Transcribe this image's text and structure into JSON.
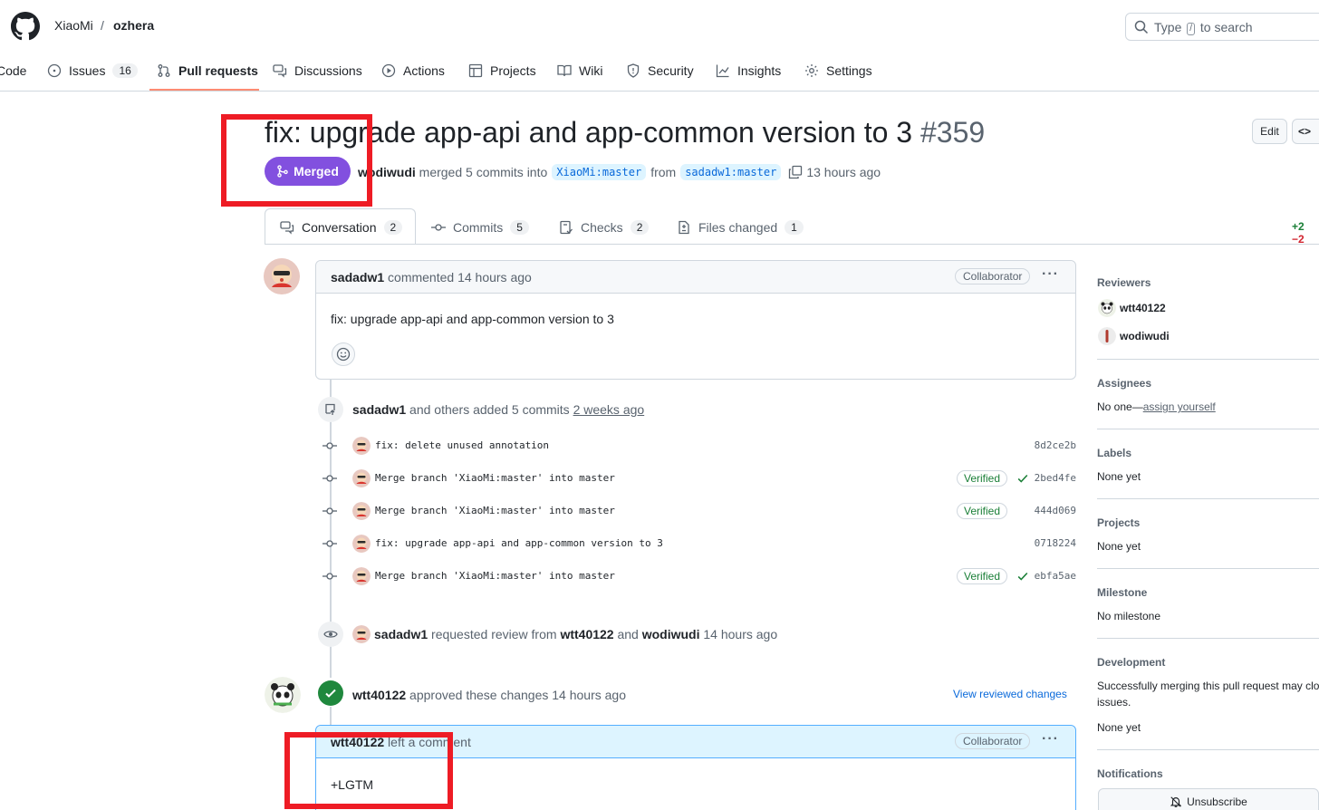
{
  "repo": {
    "owner": "XiaoMi",
    "separator": "/",
    "name": "ozhera"
  },
  "search": {
    "placeholder_prefix": "Type",
    "shortcut_key": "/",
    "placeholder_suffix": "to search"
  },
  "nav": {
    "tabs": [
      {
        "label": "Code",
        "icon": "code-icon"
      },
      {
        "label": "Issues",
        "count": "16",
        "icon": "issue-opened-icon"
      },
      {
        "label": "Pull requests",
        "icon": "git-pull-request-icon"
      },
      {
        "label": "Discussions",
        "icon": "comment-discussion-icon"
      },
      {
        "label": "Actions",
        "icon": "play-icon"
      },
      {
        "label": "Projects",
        "icon": "table-icon"
      },
      {
        "label": "Wiki",
        "icon": "book-icon"
      },
      {
        "label": "Security",
        "icon": "shield-icon"
      },
      {
        "label": "Insights",
        "icon": "graph-icon"
      },
      {
        "label": "Settings",
        "icon": "gear-icon"
      }
    ],
    "active_index": 2
  },
  "pr": {
    "title": "fix: upgrade app-api and app-common version to 3",
    "number": "#359",
    "state": "Merged",
    "author": "wodiwudi",
    "merge_text": "merged 5 commits into",
    "base_branch": "XiaoMi:master",
    "from_text": "from",
    "head_branch": "sadadw1:master",
    "time": "13 hours ago",
    "edit_label": "Edit",
    "code_label": "<>"
  },
  "pr_tabs": [
    {
      "label": "Conversation",
      "count": "2",
      "icon": "comment-discussion-icon"
    },
    {
      "label": "Commits",
      "count": "5",
      "icon": "git-commit-icon"
    },
    {
      "label": "Checks",
      "count": "2",
      "icon": "checklist-icon"
    },
    {
      "label": "Files changed",
      "count": "1",
      "icon": "file-diff-icon"
    }
  ],
  "diffstat": {
    "additions": "+2",
    "deletions": "−2"
  },
  "timeline": {
    "first_comment": {
      "author": "sadadw1",
      "action": "commented 14 hours ago",
      "role": "Collaborator",
      "body": "fix: upgrade app-api and app-common version to 3"
    },
    "commits_event": {
      "author": "sadadw1",
      "text": "and others added 5 commits",
      "time": "2 weeks ago"
    },
    "commits": [
      {
        "message": "fix: delete unused annotation",
        "sha": "8d2ce2b",
        "verified": "",
        "check": false
      },
      {
        "message": "Merge branch 'XiaoMi:master' into master",
        "sha": "2bed4fe",
        "verified": "Verified",
        "check": true
      },
      {
        "message": "Merge branch 'XiaoMi:master' into master",
        "sha": "444d069",
        "verified": "Verified",
        "check": false
      },
      {
        "message": "fix: upgrade app-api and app-common version to 3",
        "sha": "0718224",
        "verified": "",
        "check": false
      },
      {
        "message": "Merge branch 'XiaoMi:master' into master",
        "sha": "ebfa5ae",
        "verified": "Verified",
        "check": true
      }
    ],
    "review_request": {
      "author": "sadadw1",
      "text": "requested review from",
      "reviewer1": "wtt40122",
      "and": "and",
      "reviewer2": "wodiwudi",
      "time": "14 hours ago"
    },
    "approval": {
      "author": "wtt40122",
      "text": "approved these changes 14 hours ago",
      "link": "View reviewed changes"
    },
    "review_comment": {
      "author": "wtt40122",
      "action": "left a comment",
      "role": "Collaborator",
      "body": "+LGTM"
    }
  },
  "sidebar": {
    "reviewers_label": "Reviewers",
    "reviewers": [
      "wtt40122",
      "wodiwudi"
    ],
    "assignees_label": "Assignees",
    "assignees_prefix": "No one—",
    "assignees_link": "assign yourself",
    "labels_label": "Labels",
    "labels_value": "None yet",
    "projects_label": "Projects",
    "projects_value": "None yet",
    "milestone_label": "Milestone",
    "milestone_value": "No milestone",
    "development_label": "Development",
    "development_line1": "Successfully merging this pull request may clo",
    "development_line2": "issues.",
    "development_value": "None yet",
    "notifications_label": "Notifications",
    "unsubscribe_label": "Unsubscribe"
  },
  "colors": {
    "merged": "#8250df",
    "link": "#0969da",
    "verified": "#1a7f37",
    "highlight": "#ee1c25",
    "tab_underline": "#fd8c73"
  }
}
